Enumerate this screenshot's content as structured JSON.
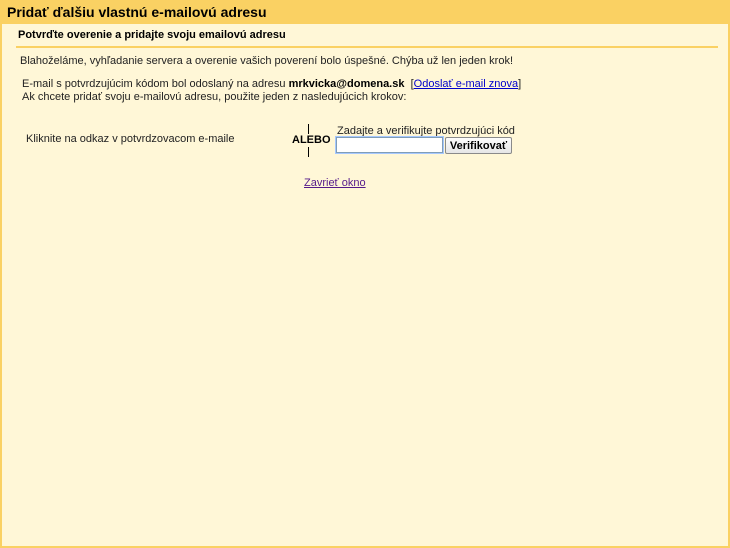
{
  "window": {
    "title": "Pridať ďalšiu vlastnú e-mailovú adresu"
  },
  "section": {
    "header": "Potvrďte overenie a pridajte svoju emailovú adresu"
  },
  "messages": {
    "success": "Blahoželáme, vyhľadanie servera a overenie vašich poverení bolo úspešné. Chýba už len jeden krok!",
    "sent_prefix": "E-mail s potvrdzujúcim kódom bol odoslaný na adresu ",
    "email": "mrkvicka@domena.sk",
    "resend_open": "[",
    "resend_link": "Odoslať e-mail znova",
    "resend_close": "]",
    "instruction": "Ak chcete pridať svoju e-mailovú adresu, použite jeden z nasledujúcich krokov:"
  },
  "options": {
    "left_label": "Kliknite na odkaz v potvrdzovacom e-maile",
    "or_label": "ALEBO",
    "code_label": "Zadajte a verifikujte potvrdzujúci kód",
    "code_value": "",
    "verify_button": "Verifikovať"
  },
  "footer": {
    "close_link": "Zavrieť okno"
  },
  "colors": {
    "title_bar": "#fad163",
    "background": "#fff7d7",
    "link": "#0000cc",
    "visited_link": "#551a8b"
  }
}
